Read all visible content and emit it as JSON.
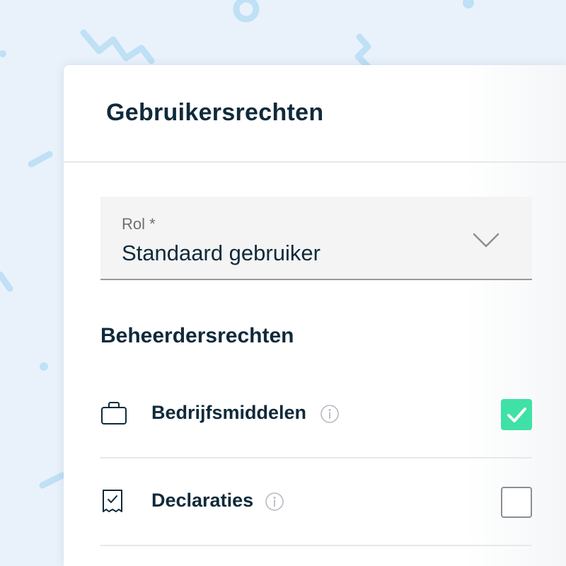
{
  "dialog": {
    "title": "Gebruikersrechten"
  },
  "role_select": {
    "label": "Rol *",
    "value": "Standaard gebruiker"
  },
  "admin_rights": {
    "heading": "Beheerdersrechten",
    "items": [
      {
        "label": "Bedrijfsmiddelen",
        "icon": "briefcase-icon",
        "checked": true
      },
      {
        "label": "Declaraties",
        "icon": "receipt-icon",
        "checked": false
      }
    ]
  },
  "colors": {
    "accent_green": "#3fe1a6",
    "text_dark": "#0f2a3a",
    "background": "#e9f2fb",
    "decoration_blue": "#bfe0f5"
  }
}
